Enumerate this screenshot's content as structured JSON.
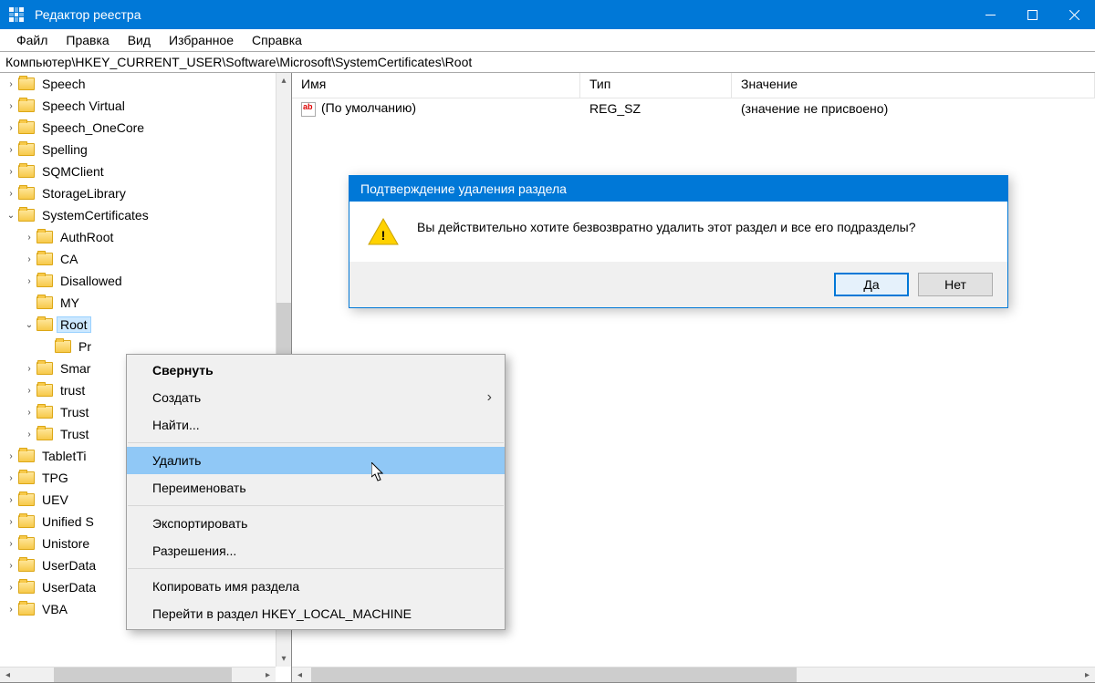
{
  "window": {
    "title": "Редактор реестра"
  },
  "menubar": [
    "Файл",
    "Правка",
    "Вид",
    "Избранное",
    "Справка"
  ],
  "address": "Компьютер\\HKEY_CURRENT_USER\\Software\\Microsoft\\SystemCertificates\\Root",
  "tree": {
    "items": [
      {
        "indent": 1,
        "exp": "›",
        "label": "Speech"
      },
      {
        "indent": 1,
        "exp": "›",
        "label": "Speech Virtual"
      },
      {
        "indent": 1,
        "exp": "›",
        "label": "Speech_OneCore"
      },
      {
        "indent": 1,
        "exp": "›",
        "label": "Spelling"
      },
      {
        "indent": 1,
        "exp": "›",
        "label": "SQMClient"
      },
      {
        "indent": 1,
        "exp": "›",
        "label": "StorageLibrary"
      },
      {
        "indent": 1,
        "exp": "⌄",
        "label": "SystemCertificates"
      },
      {
        "indent": 2,
        "exp": "›",
        "label": "AuthRoot"
      },
      {
        "indent": 2,
        "exp": "›",
        "label": "CA"
      },
      {
        "indent": 2,
        "exp": "›",
        "label": "Disallowed"
      },
      {
        "indent": 2,
        "exp": "",
        "label": "MY"
      },
      {
        "indent": 2,
        "exp": "⌄",
        "label": "Root",
        "sel": true
      },
      {
        "indent": 3,
        "exp": "",
        "label": "Pr"
      },
      {
        "indent": 2,
        "exp": "›",
        "label": "Smar"
      },
      {
        "indent": 2,
        "exp": "›",
        "label": "trust"
      },
      {
        "indent": 2,
        "exp": "›",
        "label": "Trust"
      },
      {
        "indent": 2,
        "exp": "›",
        "label": "Trust"
      },
      {
        "indent": 1,
        "exp": "›",
        "label": "TabletTi"
      },
      {
        "indent": 1,
        "exp": "›",
        "label": "TPG"
      },
      {
        "indent": 1,
        "exp": "›",
        "label": "UEV"
      },
      {
        "indent": 1,
        "exp": "›",
        "label": "Unified S"
      },
      {
        "indent": 1,
        "exp": "›",
        "label": "Unistore"
      },
      {
        "indent": 1,
        "exp": "›",
        "label": "UserData"
      },
      {
        "indent": 1,
        "exp": "›",
        "label": "UserData"
      },
      {
        "indent": 1,
        "exp": "›",
        "label": "VBA"
      }
    ]
  },
  "list": {
    "columns": [
      "Имя",
      "Тип",
      "Значение"
    ],
    "rows": [
      {
        "name": "(По умолчанию)",
        "type": "REG_SZ",
        "value": "(значение не присвоено)"
      }
    ]
  },
  "dialog": {
    "title": "Подтверждение удаления раздела",
    "message": "Вы действительно хотите безвозвратно удалить этот раздел и все его подразделы?",
    "buttons": {
      "yes": "Да",
      "no": "Нет"
    }
  },
  "ctxmenu": [
    {
      "label": "Свернуть",
      "bold": true
    },
    {
      "label": "Создать",
      "sub": true
    },
    {
      "label": "Найти..."
    },
    {
      "sep": true
    },
    {
      "label": "Удалить",
      "hl": true
    },
    {
      "label": "Переименовать"
    },
    {
      "sep": true
    },
    {
      "label": "Экспортировать"
    },
    {
      "label": "Разрешения..."
    },
    {
      "sep": true
    },
    {
      "label": "Копировать имя раздела"
    },
    {
      "label": "Перейти в раздел HKEY_LOCAL_MACHINE"
    }
  ]
}
